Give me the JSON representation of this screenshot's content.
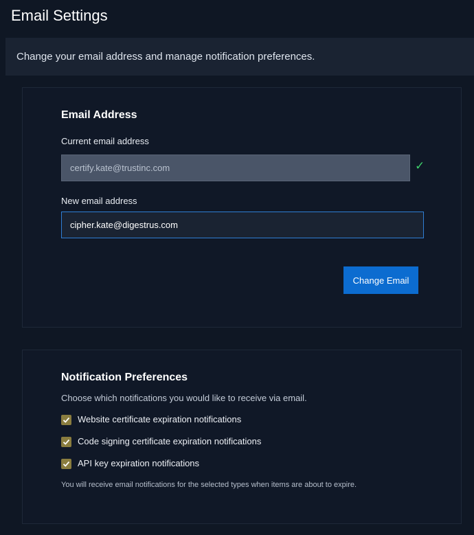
{
  "page": {
    "title": "Email Settings",
    "banner": "Change your email address and manage notification preferences."
  },
  "email_section": {
    "title": "Email Address",
    "current_label": "Current email address",
    "current_value": "certify.kate@trustinc.com",
    "verified_icon": "check-icon",
    "new_label": "New email address",
    "new_value": "cipher.kate@digestrus.com",
    "submit_label": "Change Email"
  },
  "notifications": {
    "title": "Notification Preferences",
    "description": "Choose which notifications you would like to receive via email.",
    "options": [
      {
        "label": "Website certificate expiration notifications",
        "checked": true
      },
      {
        "label": "Code signing certificate expiration notifications",
        "checked": true
      },
      {
        "label": "API key expiration notifications",
        "checked": true
      }
    ],
    "footnote": "You will receive email notifications for the selected types when items are about to expire."
  },
  "colors": {
    "background": "#0f1724",
    "card": "#101827",
    "accent": "#0c6cd0",
    "checkbox": "#8a7d3f",
    "verified": "#3ecf6b"
  }
}
